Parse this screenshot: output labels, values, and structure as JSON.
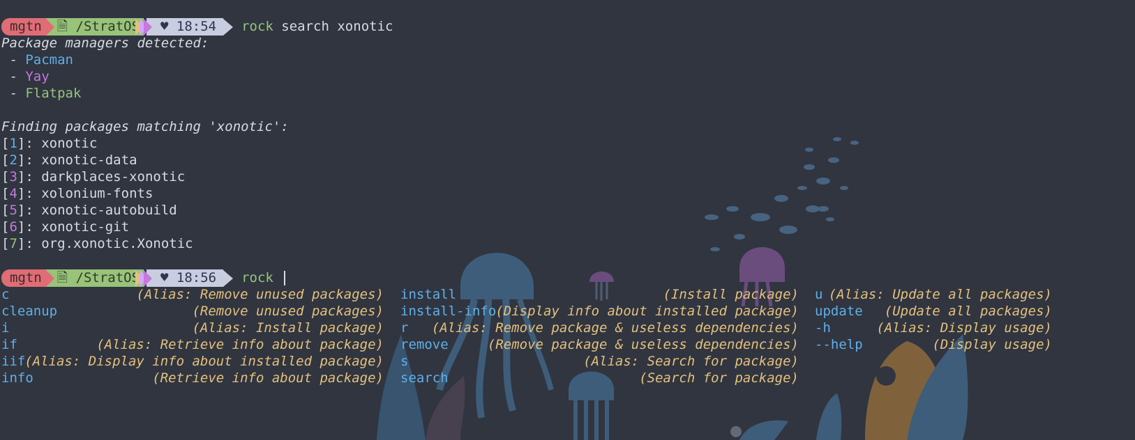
{
  "colors": {
    "background": "#303540",
    "prompt_user": "#e06c75",
    "prompt_dir": "#98c379",
    "prompt_time": "#c9cde0",
    "keyword": "#5fb0e8",
    "description": "#e5c07b"
  },
  "prompts": [
    {
      "user": "mgtn",
      "dir_icon": "file-icon",
      "dir": "/StratOS",
      "time": "♥ 18:54",
      "command_name": "rock",
      "command_args": " search xonotic"
    },
    {
      "user": "mgtn",
      "dir_icon": "file-icon",
      "dir": "/StratOS",
      "time": "♥ 18:56",
      "command_name": "rock",
      "command_args": " "
    }
  ],
  "output": {
    "managers_heading": "Package managers detected:",
    "managers": [
      {
        "prefix": " - ",
        "name": "Pacman"
      },
      {
        "prefix": " - ",
        "name": "Yay"
      },
      {
        "prefix": " - ",
        "name": "Flatpak"
      }
    ],
    "matching_heading": "Finding packages matching 'xonotic':",
    "results": [
      {
        "index": "1",
        "name": "xonotic"
      },
      {
        "index": "2",
        "name": "xonotic-data"
      },
      {
        "index": "3",
        "name": "darkplaces-xonotic"
      },
      {
        "index": "4",
        "name": "xolonium-fonts"
      },
      {
        "index": "5",
        "name": "xonotic-autobuild"
      },
      {
        "index": "6",
        "name": "xonotic-git"
      },
      {
        "index": "7",
        "name": "org.xonotic.Xonotic"
      }
    ]
  },
  "completions": {
    "col1": [
      {
        "cmd": "c",
        "desc": "(Alias: Remove unused packages)"
      },
      {
        "cmd": "cleanup",
        "desc": "(Remove unused packages)"
      },
      {
        "cmd": "i",
        "desc": "(Alias: Install package)"
      },
      {
        "cmd": "if",
        "desc": "(Alias: Retrieve info about package)"
      },
      {
        "cmd": "iif",
        "desc": "(Alias: Display info about installed package)"
      },
      {
        "cmd": "info",
        "desc": "(Retrieve info about package)"
      }
    ],
    "col2": [
      {
        "cmd": "install",
        "desc": "(Install package)"
      },
      {
        "cmd": "install-info",
        "desc": "(Display info about installed package)"
      },
      {
        "cmd": "r",
        "desc": "(Alias: Remove package & useless dependencies)"
      },
      {
        "cmd": "remove",
        "desc": "(Remove package & useless dependencies)"
      },
      {
        "cmd": "s",
        "desc": "(Alias: Search for package)"
      },
      {
        "cmd": "search",
        "desc": "(Search for package)"
      }
    ],
    "col3": [
      {
        "cmd": "u",
        "desc": "(Alias: Update all packages)"
      },
      {
        "cmd": "update",
        "desc": "(Update all packages)"
      },
      {
        "cmd": "-h",
        "desc": "(Alias: Display usage)"
      },
      {
        "cmd": "--help",
        "desc": "(Display usage)"
      }
    ]
  }
}
